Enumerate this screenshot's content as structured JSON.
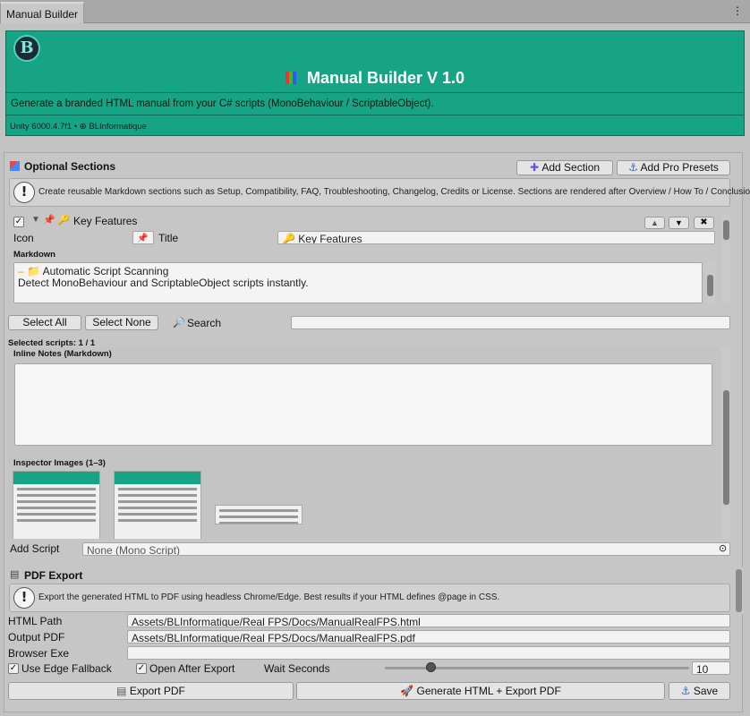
{
  "window": {
    "tab": "Manual Builder",
    "menu": "⋮"
  },
  "banner": {
    "logo": "B",
    "title": "Manual Builder V 1.0",
    "subtitle": "Generate a branded HTML manual from your C# scripts (MonoBehaviour / ScriptableObject).",
    "meta": "Unity 6000.4.7f1 • ⊕ BLInformatique",
    "brand_color": "#17a485"
  },
  "optional": {
    "title": "Optional Sections",
    "add_section": "Add Section",
    "add_presets": "Add Pro Presets",
    "help": "Create reusable Markdown sections such as Setup, Compatibility, FAQ, Troubleshooting, Changelog, Credits or License. Sections are rendered after Overview / How To / Conclusion.",
    "section": {
      "name": "Key Features",
      "icon_label": "Icon",
      "title_label": "Title",
      "title_value": "Key Features",
      "markdown_label": "Markdown",
      "markdown_line1": "Automatic Script Scanning",
      "markdown_line2": "Detect MonoBehaviour and ScriptableObject scripts instantly."
    }
  },
  "scripts": {
    "select_all": "Select All",
    "select_none": "Select None",
    "search": "Search",
    "search_value": "",
    "selected": "Selected scripts: 1 / 1",
    "inline_notes": "Inline Notes (Markdown)",
    "inspector_images": "Inspector Images (1–3)",
    "add_script_label": "Add Script",
    "add_script_value": "None (Mono Script)"
  },
  "pdf": {
    "title": "PDF Export",
    "help": "Export the generated HTML to PDF using headless Chrome/Edge. Best results if your HTML defines @page in CSS.",
    "html_path_label": "HTML Path",
    "html_path": "Assets/BLInformatique/Real FPS/Docs/ManualRealFPS.html",
    "output_label": "Output PDF",
    "output": "Assets/BLInformatique/Real FPS/Docs/ManualRealFPS.pdf",
    "browser_label": "Browser Exe",
    "browser": "",
    "edge_fallback": "Use Edge Fallback",
    "open_after": "Open After Export",
    "wait_label": "Wait Seconds",
    "wait_value": "10",
    "wait_fraction": 0.15
  },
  "footer": {
    "export_pdf": "Export PDF",
    "generate": "Generate HTML + Export PDF",
    "save": "Save"
  }
}
